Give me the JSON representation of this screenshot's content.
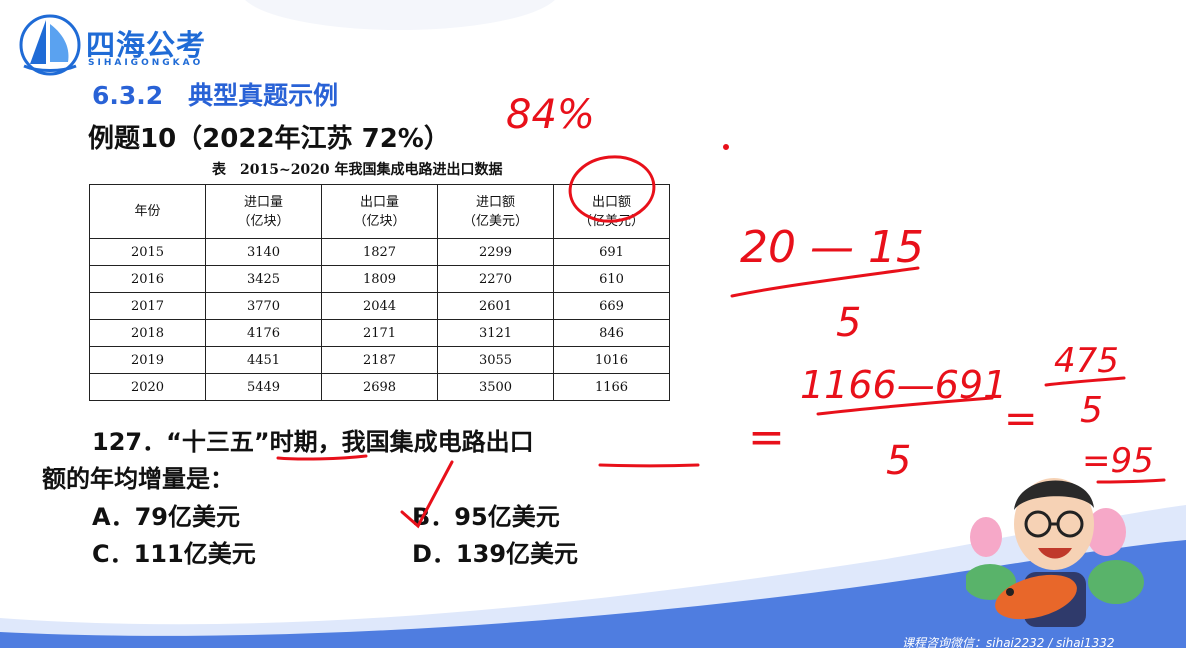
{
  "logo": {
    "name": "四海公考",
    "sub": "SIHAIGONGKAO"
  },
  "section_title": "6.3.2　典型真题示例",
  "example_title": "例题10（2022年江苏 72%）",
  "table": {
    "caption": "表　2015~2020 年我国集成电路进出口数据",
    "headers": [
      {
        "line1": "年份",
        "line2": ""
      },
      {
        "line1": "进口量",
        "line2": "（亿块）"
      },
      {
        "line1": "出口量",
        "line2": "（亿块）"
      },
      {
        "line1": "进口额",
        "line2": "（亿美元）"
      },
      {
        "line1": "出口额",
        "line2": "（亿美元）"
      }
    ],
    "rows": [
      [
        "2015",
        "3140",
        "1827",
        "2299",
        "691"
      ],
      [
        "2016",
        "3425",
        "1809",
        "2270",
        "610"
      ],
      [
        "2017",
        "3770",
        "2044",
        "2601",
        "669"
      ],
      [
        "2018",
        "4176",
        "2171",
        "3121",
        "846"
      ],
      [
        "2019",
        "4451",
        "2187",
        "3055",
        "1016"
      ],
      [
        "2020",
        "5449",
        "2698",
        "3500",
        "1166"
      ]
    ]
  },
  "question": {
    "line1": "127．“十三五”时期，我国集成电路出口",
    "line2": "额的年均增量是：",
    "options": {
      "a": "A．79亿美元",
      "b": "B．95亿美元",
      "c": "C．111亿美元",
      "d": "D．139亿美元"
    }
  },
  "handwriting": {
    "percent": "84%",
    "num1": "20 — 15",
    "den1": "5",
    "eq1": "=",
    "num2": "1166—691",
    "den2": "5",
    "eq2": "=",
    "num3": "475",
    "den3": "5",
    "result": "=95"
  },
  "footer": "课程咨询微信：sihai2232 / sihai1332",
  "colors": {
    "brand": "#1f6bd6",
    "ink": "#e8101a",
    "wave": "#4f7de0"
  }
}
